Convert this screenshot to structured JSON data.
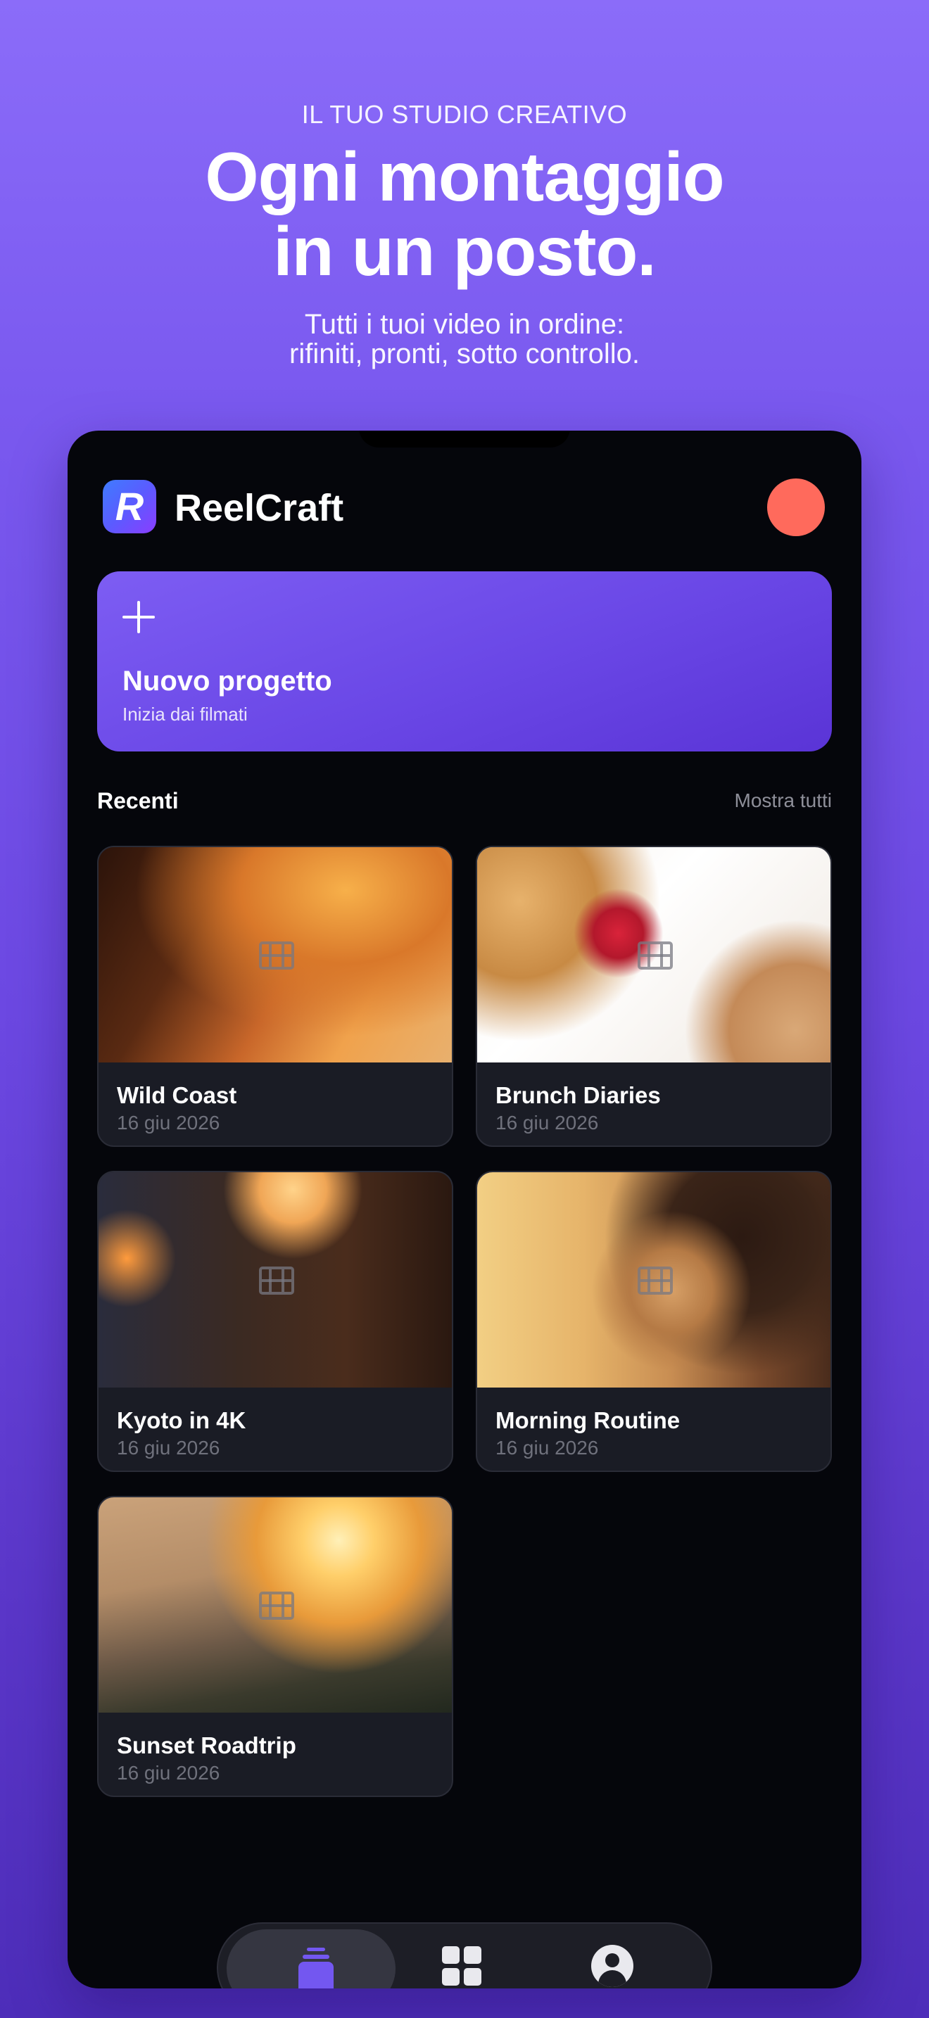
{
  "hero": {
    "eyebrow": "IL TUO STUDIO CREATIVO",
    "headline_line1": "Ogni montaggio",
    "headline_line2": "in un posto.",
    "subline_line1": "Tutti i tuoi video in ordine:",
    "subline_line2": "rifiniti, pronti, sotto controllo."
  },
  "app": {
    "name": "ReelCraft",
    "logo_letter": "R",
    "accent": "#6a47e6",
    "avatar_color": "#ff6a5c"
  },
  "new_project": {
    "title": "Nuovo progetto",
    "subtitle": "Inizia dai filmati"
  },
  "recents": {
    "title": "Recenti",
    "show_all": "Mostra tutti"
  },
  "projects": [
    {
      "name": "Wild Coast",
      "date": "16 giu 2026"
    },
    {
      "name": "Brunch Diaries",
      "date": "16 giu 2026"
    },
    {
      "name": "Kyoto in 4K",
      "date": "16 giu 2026"
    },
    {
      "name": "Morning Routine",
      "date": "16 giu 2026"
    },
    {
      "name": "Sunset Roadtrip",
      "date": "16 giu 2026"
    }
  ],
  "tabbar": {
    "tabs": [
      {
        "icon": "projects-stack-icon",
        "active": true
      },
      {
        "icon": "grid-icon",
        "active": false
      },
      {
        "icon": "profile-icon",
        "active": false
      }
    ]
  }
}
